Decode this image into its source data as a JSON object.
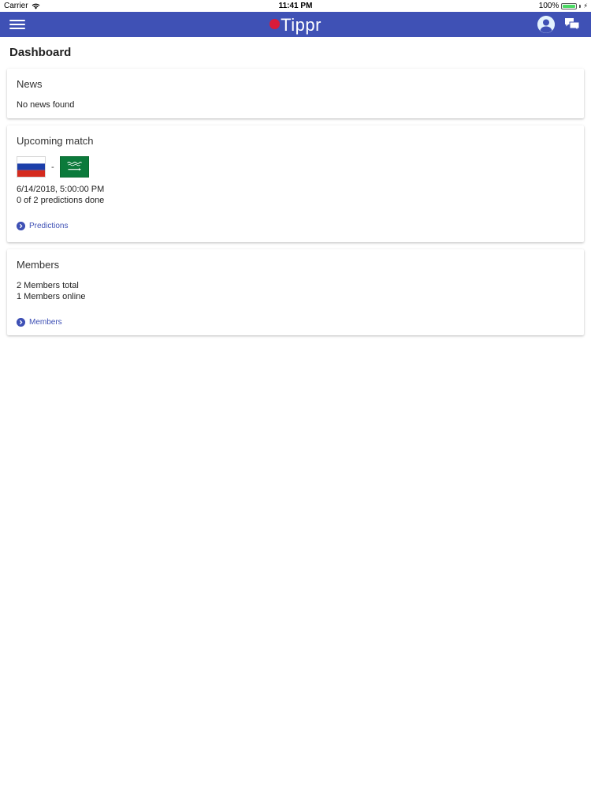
{
  "status_bar": {
    "carrier": "Carrier",
    "time": "11:41 PM",
    "battery": "100%",
    "battery_level": 1.0
  },
  "app_bar": {
    "logo_text": "Tippr",
    "background": "#3f51b5",
    "accent": "#d81b3a",
    "icons": [
      "menu-icon",
      "account-icon",
      "chat-icon"
    ]
  },
  "page": {
    "title": "Dashboard"
  },
  "news": {
    "title": "News",
    "message": "No news found"
  },
  "upcoming_match": {
    "title": "Upcoming match",
    "home_flag": "russia-flag-icon",
    "separator": "-",
    "away_flag": "saudi-arabia-flag-icon",
    "datetime": "6/14/2018, 5:00:00 PM",
    "predictions": "0 of 2 predictions done",
    "link_label": "Predictions"
  },
  "members": {
    "title": "Members",
    "total": "2 Members total",
    "online": "1 Members online",
    "link_label": "Members"
  }
}
